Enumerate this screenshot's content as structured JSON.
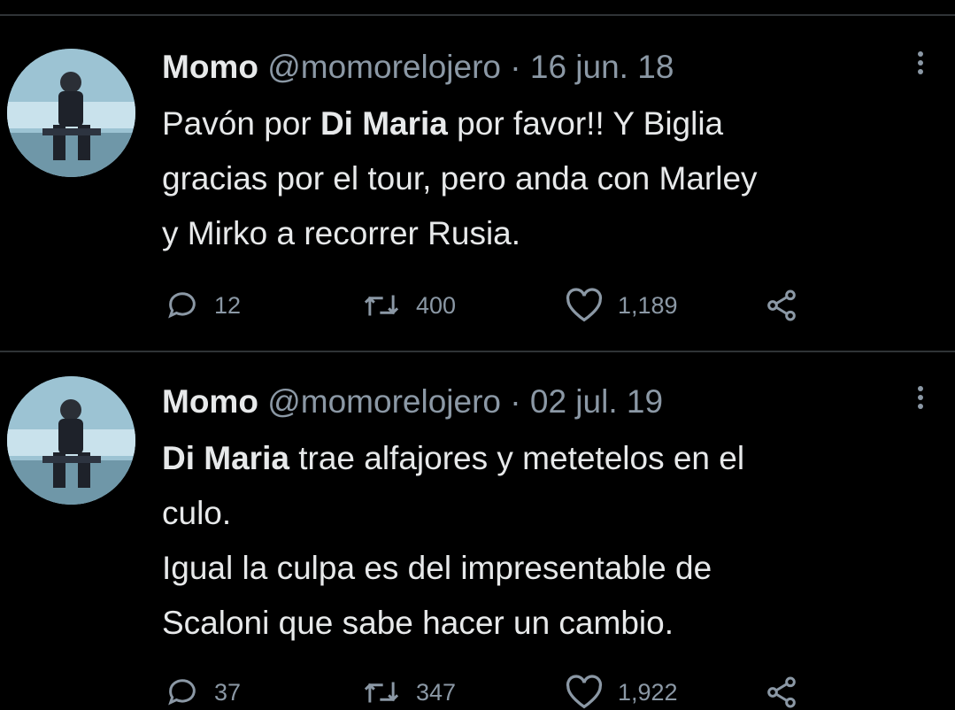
{
  "tweets": [
    {
      "name": "Momo",
      "handle": "@momorelojero",
      "separator": "·",
      "date": "16 jun. 18",
      "text": {
        "line1_pre": "Pavón por ",
        "line1_bold": "Di Maria",
        "line1_post": " por favor!! Y Biglia",
        "line2": "gracias por el tour, pero anda con Marley",
        "line3": "y Mirko a recorrer Rusia."
      },
      "replies": "12",
      "retweets": "400",
      "likes": "1,189"
    },
    {
      "name": "Momo",
      "handle": "@momorelojero",
      "separator": "·",
      "date": "02 jul. 19",
      "text": {
        "line1_bold": "Di Maria",
        "line1_post": " trae alfajores y metetelos en el",
        "line2": "culo.",
        "line3": "Igual la culpa es del impresentable de",
        "line4": "Scaloni que sabe hacer un cambio."
      },
      "replies": "37",
      "retweets": "347",
      "likes": "1,922"
    }
  ],
  "icons": [
    "more-icon",
    "reply-icon",
    "retweet-icon",
    "like-icon",
    "share-icon"
  ],
  "colors": {
    "background": "#000000",
    "text": "#e7e9ea",
    "muted": "#8b98a5",
    "divider": "#2f3336"
  }
}
